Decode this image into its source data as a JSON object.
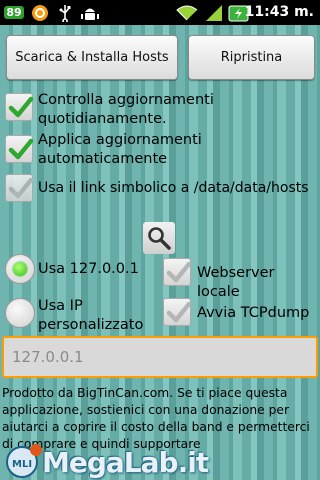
{
  "statusbar": {
    "notification_count": "89",
    "time": "11:43 m."
  },
  "buttons": {
    "install_label": "Scarica & Installa Hosts",
    "restore_label": "Ripristina"
  },
  "options": {
    "daily_check": {
      "label": "Controlla aggiornamenti quotidianamente.",
      "checked": true
    },
    "auto_apply": {
      "label": "Applica aggiornamenti automaticamente",
      "checked": true
    },
    "symlink": {
      "label": "Usa il link simbolico a /data/data/hosts",
      "checked": true,
      "enabled": false
    },
    "webserver": {
      "label": "Webserver locale",
      "checked": true,
      "enabled": false
    },
    "tcpdump": {
      "label": "Avvia TCPdump",
      "checked": true,
      "enabled": false
    }
  },
  "ip_choice": {
    "localhost_label": "Usa 127.0.0.1",
    "custom_label": "Usa IP personalizzato",
    "selected": "localhost"
  },
  "ip_field": {
    "placeholder": "127.0.0.1"
  },
  "info_text": "Prodotto da BigTinCan.com. Se ti piace questa applicazione, sostienici con una donazione per aiutarci a coprire il costo della band e permetterci di comprare e quindi supportare",
  "watermark": {
    "logo_letters": "MLI",
    "text": "MegaLab.it"
  },
  "colors": {
    "check_green": "#2fa82f",
    "focus_orange": "#ff9c00"
  }
}
